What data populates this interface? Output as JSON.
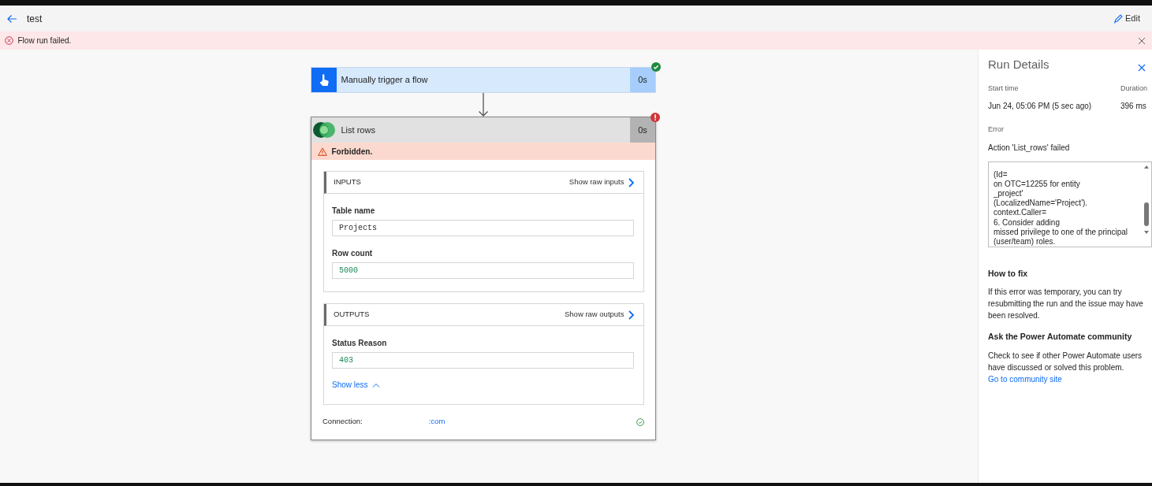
{
  "header": {
    "title": "test",
    "edit_label": "Edit"
  },
  "banner": {
    "message": "Flow run failed."
  },
  "trigger": {
    "title": "Manually trigger a flow",
    "duration": "0s",
    "failed": false
  },
  "action": {
    "title": "List rows",
    "duration": "0s",
    "failed": true,
    "error": "Forbidden.",
    "inputs": {
      "heading": "INPUTS",
      "raw_link": "Show raw inputs",
      "fields": [
        {
          "label": "Table name",
          "value": "Projects",
          "kind": "text"
        },
        {
          "label": "Row count",
          "value": "5000",
          "kind": "number"
        }
      ]
    },
    "outputs": {
      "heading": "OUTPUTS",
      "raw_link": "Show raw outputs",
      "fields": [
        {
          "label": "Status Reason",
          "value": "403",
          "kind": "number"
        }
      ]
    },
    "show_less": "Show less",
    "connection": {
      "label": "Connection:",
      "value": ":com",
      "connected": true
    }
  },
  "run_details": {
    "title": "Run Details",
    "start_label": "Start time",
    "start_value": "Jun 24, 05:06 PM (5 sec ago)",
    "duration_label": "Duration",
    "duration_value": "396 ms",
    "error_label": "Error",
    "error_summary": "Action 'List_rows' failed",
    "error_lines": [
      "(Id=",
      "on OTC=12255 for entity",
      "_project'",
      "(LocalizedName='Project').",
      "context.Caller=",
      "6. Consider adding",
      "missed privilege to one of the principal",
      "(user/team) roles."
    ],
    "fix_heading": "How to fix",
    "fix_text": "If this error was temporary, you can try resubmitting the run and the issue may have been resolved.",
    "community_heading": "Ask the Power Automate community",
    "community_text": "Check to see if other Power Automate users have discussed or solved this problem.",
    "community_link": "Go to community site"
  }
}
